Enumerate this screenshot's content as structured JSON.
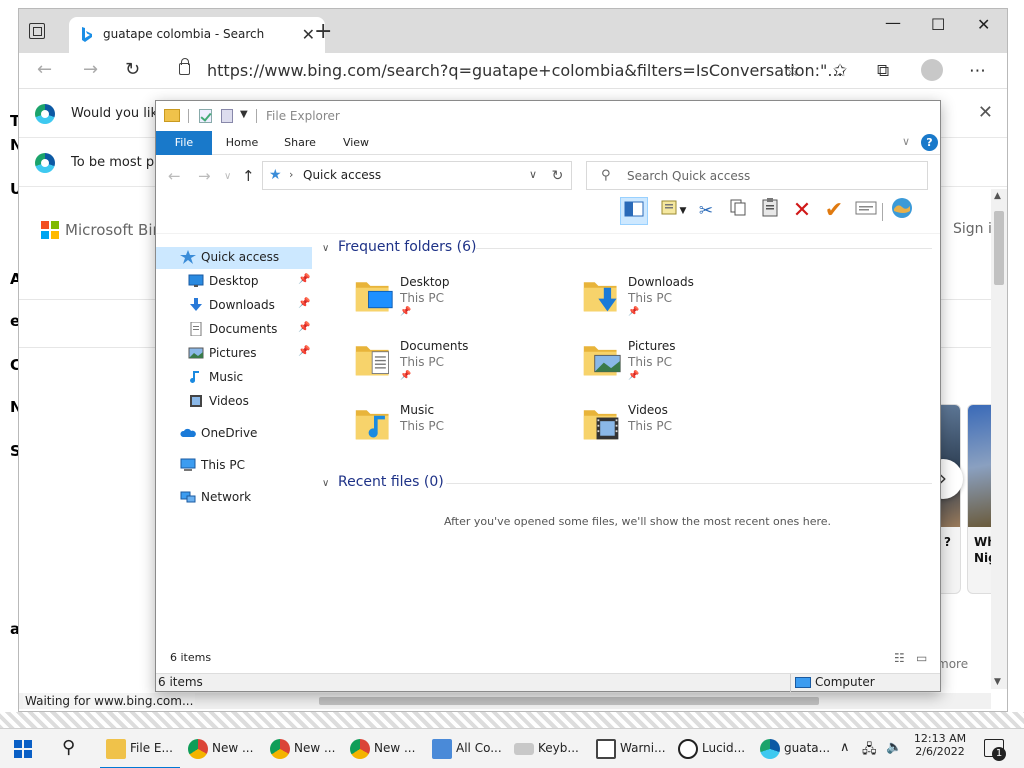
{
  "browser": {
    "tab_title": "guatape colombia - Search",
    "url": "https://www.bing.com/search?q=guatape+colombia&filters=IsConversation:\"...",
    "notification1": "Would you like",
    "notification2": "To be most pro",
    "bing_brand": "Microsoft Bing",
    "sign_in": "Sign i",
    "status": "Waiting for www.bing.com...",
    "more": "more",
    "card1_text": "?",
    "card2_text_line1": "Wh",
    "card2_text_line2": "Nig"
  },
  "explorer": {
    "title": "File Explorer",
    "ribbon_tabs": [
      "File",
      "Home",
      "Share",
      "View"
    ],
    "address": "Quick access",
    "search_placeholder": "Search Quick access",
    "nav_pane": [
      {
        "label": "Quick access",
        "icon": "star-icon",
        "pinned": false,
        "selected": true
      },
      {
        "label": "Desktop",
        "icon": "desktop-icon",
        "pinned": true
      },
      {
        "label": "Downloads",
        "icon": "download-icon",
        "pinned": true
      },
      {
        "label": "Documents",
        "icon": "documents-icon",
        "pinned": true
      },
      {
        "label": "Pictures",
        "icon": "pictures-icon",
        "pinned": true
      },
      {
        "label": "Music",
        "icon": "music-icon",
        "pinned": false
      },
      {
        "label": "Videos",
        "icon": "videos-icon",
        "pinned": false
      },
      {
        "label": "OneDrive",
        "icon": "onedrive-icon",
        "pinned": false
      },
      {
        "label": "This PC",
        "icon": "this-pc-icon",
        "pinned": false
      },
      {
        "label": "Network",
        "icon": "network-icon",
        "pinned": false
      }
    ],
    "frequent_header": "Frequent folders (6)",
    "folders": [
      {
        "name": "Desktop",
        "location": "This PC",
        "pinned": true
      },
      {
        "name": "Downloads",
        "location": "This PC",
        "pinned": true
      },
      {
        "name": "Documents",
        "location": "This PC",
        "pinned": true
      },
      {
        "name": "Pictures",
        "location": "This PC",
        "pinned": true
      },
      {
        "name": "Music",
        "location": "This PC",
        "pinned": false
      },
      {
        "name": "Videos",
        "location": "This PC",
        "pinned": false
      }
    ],
    "recent_header": "Recent files (0)",
    "recent_empty": "After you've opened some files, we'll show the most recent ones here.",
    "items_count": "6 items",
    "status_items": "6 items",
    "status_location": "Computer"
  },
  "taskbar": {
    "items": [
      {
        "label": "File E...",
        "icon": "file-explorer-icon",
        "active": true
      },
      {
        "label": "New ...",
        "icon": "chrome-icon"
      },
      {
        "label": "New ...",
        "icon": "chrome-icon"
      },
      {
        "label": "New ...",
        "icon": "chrome-icon"
      },
      {
        "label": "All Co...",
        "icon": "control-panel-icon"
      },
      {
        "label": "Keyb...",
        "icon": "keyboard-icon"
      },
      {
        "label": "Warni...",
        "icon": "warning-icon"
      },
      {
        "label": "Lucid...",
        "icon": "lucid-icon"
      },
      {
        "label": "guata...",
        "icon": "edge-icon"
      }
    ],
    "time": "12:13 AM",
    "date": "2/6/2022",
    "notification_count": "1"
  },
  "colors": {
    "accent": "#1979ca",
    "selection": "#cce8ff",
    "folder": "#f0c24a",
    "heading": "#1e3287"
  }
}
